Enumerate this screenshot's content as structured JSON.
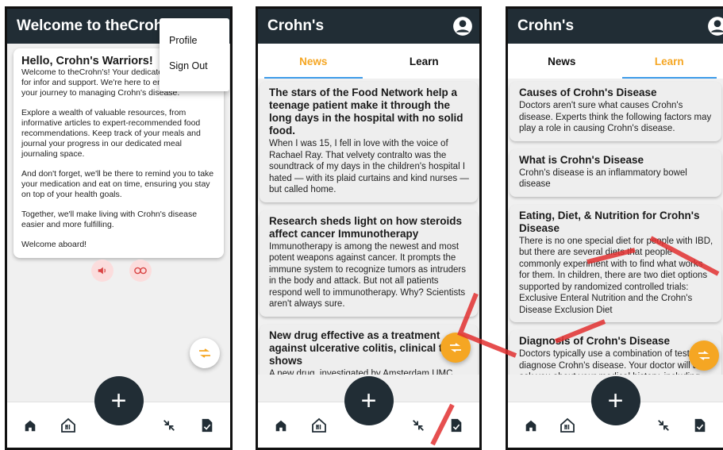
{
  "colors": {
    "appbar": "#212d35",
    "accent": "#f5a623",
    "tab_indicator": "#3d9be9",
    "background": "#f0f0f0"
  },
  "screen1": {
    "title": "Welcome to theCrohn",
    "menu": {
      "profile": "Profile",
      "sign_out": "Sign Out"
    },
    "welcome_title": "Hello, Crohn's Warriors!",
    "paragraphs": [
      "Welcome to theCrohn's! Your dedicated companion for infor and support. We're here to empower you on your journey to managing Crohn's disease.",
      "Explore a wealth of valuable resources, from informative articles to expert-recommended food recommendations. Keep track of your meals and journal your progress in our dedicated meal journaling space.",
      "And don't forget, we'll be there to remind you to take your medication and eat on time, ensuring you stay on top of your health goals.",
      "Together, we'll make living with Crohn's disease easier and more fulfilling.",
      "Welcome aboard!"
    ],
    "icons": [
      "speaker-icon",
      "link-icon",
      "swap-icon"
    ]
  },
  "screen2": {
    "title": "Crohn's",
    "tabs": {
      "news": "News",
      "learn": "Learn"
    },
    "active_tab": "news",
    "articles": [
      {
        "title": "The stars of the Food Network help a teenage patient make it through the long days in the hospital with no solid food.",
        "body": "When I was 15, I fell in love with the voice of Rachael Ray. That velvety contralto was the soundtrack of my days in the children's hospital I hated — with its plaid curtains and kind nurses — but called home."
      },
      {
        "title": "Research sheds light on how steroids affect cancer Immunotherapy",
        "body": "Immunotherapy is among the newest and most potent weapons against cancer. It prompts the immune system to recognize tumors as intruders in the body and attack. But not all patients respond well to immunotherapy. Why? Scientists aren't always sure."
      },
      {
        "title": "New drug effective as a treatment against ulcerative colitis, clinical trial shows",
        "body": "A new drug, investigated by Amsterdam UMC together with colleagues around the"
      }
    ]
  },
  "screen3": {
    "title": "Crohn's",
    "tabs": {
      "news": "News",
      "learn": "Learn"
    },
    "active_tab": "learn",
    "articles": [
      {
        "title": "Causes of Crohn's Disease",
        "body": "Doctors aren't sure what causes Crohn's disease. Experts think the following factors may play a role in causing Crohn's disease."
      },
      {
        "title": "What is Crohn's Disease",
        "body": "Crohn's disease is an inflammatory bowel disease"
      },
      {
        "title": "Eating, Diet, & Nutrition for Crohn's Disease",
        "body": "There is no one special diet for people with IBD, but there are several diets that people commonly experiment with to find what works for them.  In children, there are two diet options supported by randomized controlled trials: Exclusive Enteral Nutrition and the Crohn's Disease Exclusion Diet"
      },
      {
        "title": "Diagnosis of Crohn's Disease",
        "body": "Doctors typically use a combination of tests to diagnose Crohn's disease. Your doctor will also ask you about your medical history, including medicines you are taking—and family history and will perform a physical exam."
      }
    ]
  },
  "bottom_nav": [
    "home-icon",
    "restaurant-icon",
    "add-icon",
    "collapse-icon",
    "journal-icon"
  ],
  "fab_symbol": "+"
}
